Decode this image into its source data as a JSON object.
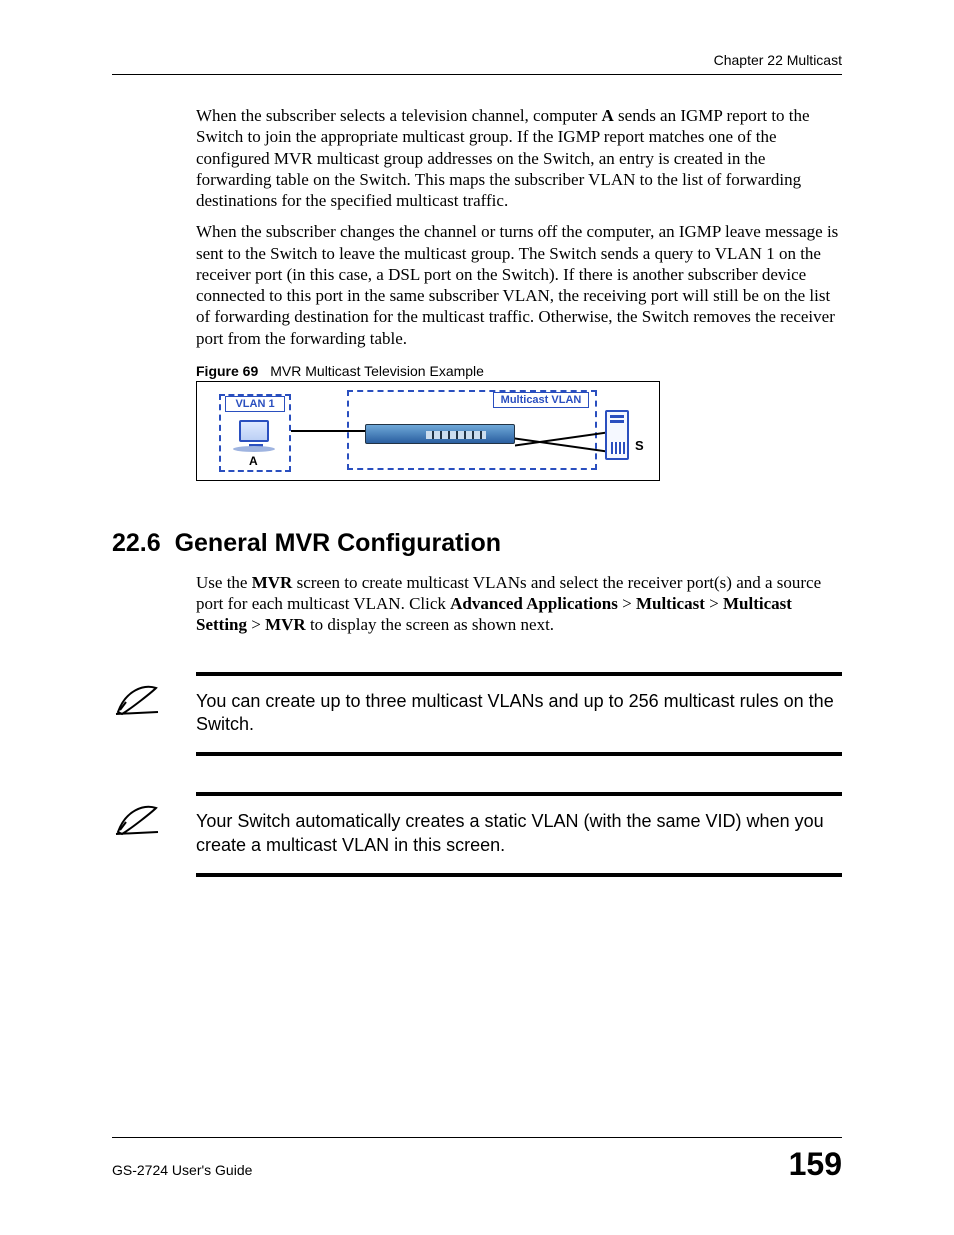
{
  "header": {
    "chapter": "Chapter 22 Multicast"
  },
  "para1_pre": "When the subscriber selects a television channel, computer ",
  "para1_bold": "A",
  "para1_post": " sends an IGMP report to the Switch to join the appropriate multicast group. If the IGMP report matches one of the configured MVR multicast group addresses on the Switch, an entry is created in the forwarding table on the Switch. This maps the subscriber VLAN to the list of forwarding destinations for the specified multicast traffic.",
  "para2": "When the subscriber changes the channel or turns off the computer, an IGMP leave message is sent to the Switch to leave the multicast group. The Switch sends a query to VLAN 1 on the receiver port (in this case, a DSL port on the Switch). If there is another subscriber device connected to this port in the same subscriber VLAN, the receiving port will still be on the list of forwarding destination for the multicast traffic. Otherwise, the Switch removes the receiver port from the forwarding table.",
  "figure": {
    "num": "Figure 69",
    "title": "MVR Multicast Television Example",
    "vlan1": "VLAN 1",
    "mvlan": "Multicast VLAN",
    "a": "A",
    "s": "S"
  },
  "section": {
    "num": "22.6",
    "title": "General MVR Configuration",
    "intro_pre": "Use the ",
    "intro_b1": "MVR",
    "intro_mid1": " screen to create multicast VLANs and select the receiver port(s) and a source port for each multicast VLAN. Click ",
    "intro_b2": "Advanced Applications",
    "intro_gt1": " > ",
    "intro_b3": "Multicast",
    "intro_gt2": " > ",
    "intro_b4": "Multicast Setting",
    "intro_gt3": " > ",
    "intro_b5": "MVR",
    "intro_post": " to display the screen as shown next."
  },
  "note1": "You can create up to three multicast VLANs and up to 256 multicast rules on the Switch.",
  "note2": "Your Switch automatically creates a static VLAN (with the same VID) when you create a multicast VLAN in this screen.",
  "footer": {
    "guide": "GS-2724 User's Guide",
    "page": "159"
  }
}
